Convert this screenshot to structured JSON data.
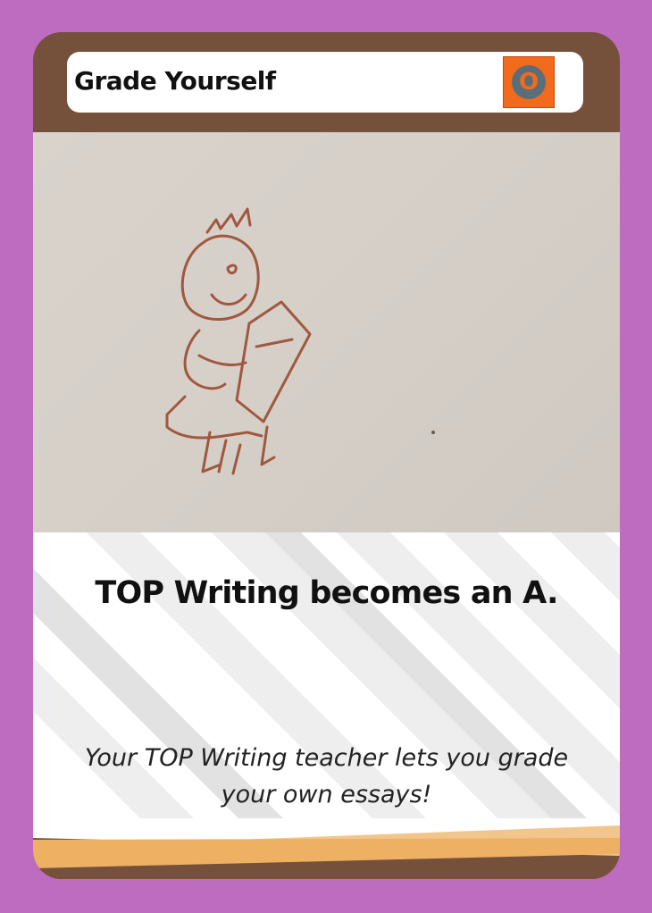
{
  "card": {
    "title": "Grade Yourself",
    "badge_letter": "O",
    "headline": "TOP Writing becomes an A.",
    "description": "Your TOP Writing teacher lets you grade your own essays!"
  },
  "colors": {
    "background": "#bd6cbf",
    "frame": "#75503a",
    "badge": "#f26a1b",
    "accent_band": "#eeb063"
  },
  "icons": {
    "badge": "orange-square-badge",
    "illustration": "stick-figure-holding-paper-drawing"
  }
}
